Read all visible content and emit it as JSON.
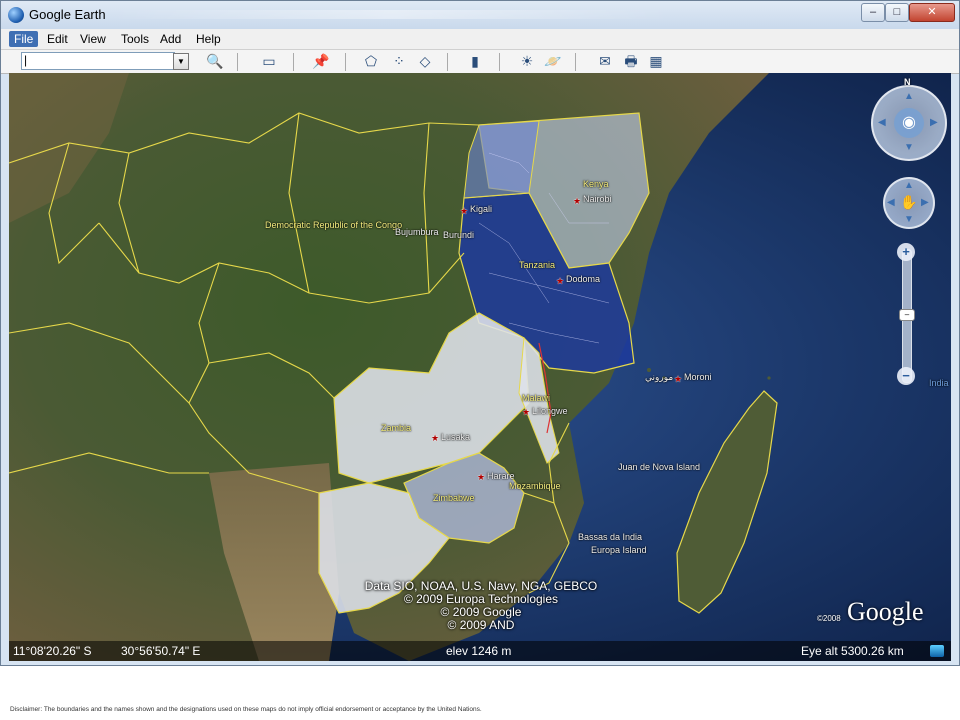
{
  "window": {
    "title": "Google Earth",
    "controls": {
      "minimize": "–",
      "maximize": "□",
      "close": "✕"
    }
  },
  "menu": {
    "items": [
      "File",
      "Edit",
      "View",
      "Tools",
      "Add",
      "Help"
    ],
    "active": "File"
  },
  "toolbar": {
    "search_value": "|",
    "icons": [
      "search-icon",
      "sidebar-icon",
      "placemark-icon",
      "polygon-icon",
      "path-icon",
      "image-overlay-icon",
      "ruler-icon",
      "sun-icon",
      "planet-icon",
      "email-icon",
      "print-icon",
      "maps-icon"
    ]
  },
  "map": {
    "countries": [
      {
        "name": "Democratic Republic of the Congo"
      },
      {
        "name": "Kenya"
      },
      {
        "name": "Tanzania"
      },
      {
        "name": "Zambia"
      },
      {
        "name": "Malawi"
      },
      {
        "name": "Zimbabwe"
      },
      {
        "name": "Mozambique"
      },
      {
        "name": "Burundi"
      },
      {
        "name": "India"
      }
    ],
    "cities": [
      {
        "name": "Kigali"
      },
      {
        "name": "Nairobi"
      },
      {
        "name": "Bujumbura"
      },
      {
        "name": "Dodoma"
      },
      {
        "name": "Moroni"
      },
      {
        "name": "موروني"
      },
      {
        "name": "Lilongwe"
      },
      {
        "name": "Lusaka"
      },
      {
        "name": "Harare"
      }
    ],
    "islands": [
      "Juan de Nova Island",
      "Bassas da India",
      "Europa Island"
    ],
    "credits": [
      "Data SIO, NOAA, U.S. Navy, NGA, GEBCO",
      "© 2009 Europa Technologies",
      "© 2009 Google",
      "© 2009 AND"
    ],
    "logo": "Google",
    "logo_year": "©2008",
    "highlight_colors": {
      "blue": "#1d3a9c",
      "white": "#dfe3ea"
    }
  },
  "nav": {
    "north": "N",
    "zoom_in": "+",
    "zoom_out": "−"
  },
  "status": {
    "lat": "11°08'20.26\" S",
    "lon": "30°56'50.74\" E",
    "elev": "elev  1246 m",
    "eye": "Eye alt  5300.26 km"
  },
  "disclaimer": "Disclaimer: The boundaries and the names shown and the designations used on these maps do not imply official endorsement or acceptance by the United Nations."
}
